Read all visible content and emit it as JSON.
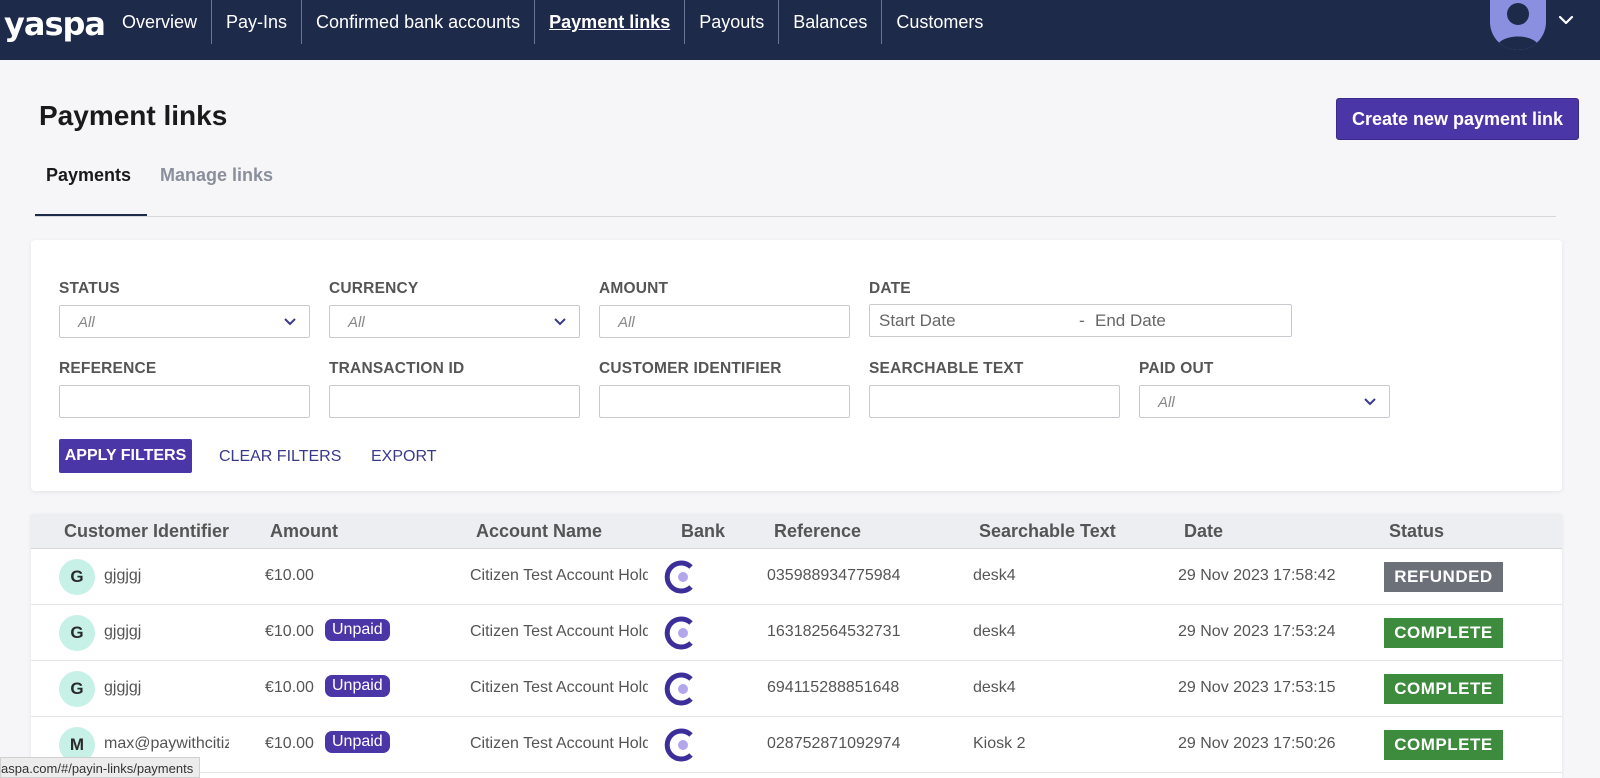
{
  "nav": {
    "logo": "yaspa",
    "items": [
      {
        "label": "Overview"
      },
      {
        "label": "Pay-Ins"
      },
      {
        "label": "Confirmed bank accounts"
      },
      {
        "label": "Payment links"
      },
      {
        "label": "Payouts"
      },
      {
        "label": "Balances"
      },
      {
        "label": "Customers"
      }
    ],
    "active": "Payment links"
  },
  "page": {
    "title": "Payment links",
    "create_button": "Create new payment link"
  },
  "tabs": [
    {
      "label": "Payments",
      "active": true
    },
    {
      "label": "Manage links",
      "active": false
    }
  ],
  "filters": {
    "status": {
      "label": "STATUS",
      "value": "All"
    },
    "currency": {
      "label": "CURRENCY",
      "value": "All"
    },
    "amount": {
      "label": "AMOUNT",
      "placeholder": "All"
    },
    "date": {
      "label": "DATE",
      "start_placeholder": "Start Date",
      "separator": "-",
      "end_placeholder": "End Date"
    },
    "reference": {
      "label": "REFERENCE",
      "value": ""
    },
    "transaction_id": {
      "label": "TRANSACTION ID",
      "value": ""
    },
    "customer_identifier": {
      "label": "CUSTOMER IDENTIFIER",
      "value": ""
    },
    "searchable_text": {
      "label": "SEARCHABLE TEXT",
      "value": ""
    },
    "paid_out": {
      "label": "PAID OUT",
      "value": "All"
    },
    "apply_label": "APPLY FILTERS",
    "clear_label": "CLEAR FILTERS",
    "export_label": "EXPORT"
  },
  "table": {
    "columns": [
      "Customer Identifier",
      "Amount",
      "Account Name",
      "Bank",
      "Reference",
      "Searchable Text",
      "Date",
      "Status"
    ],
    "rows": [
      {
        "initial": "G",
        "customer": "gjgjgj",
        "amount": "€10.00",
        "unpaid": "",
        "account": "Citizen Test Account Holder",
        "reference": "035988934775984",
        "searchable": "desk4",
        "date": "29 Nov 2023 17:58:42",
        "status": "REFUNDED"
      },
      {
        "initial": "G",
        "customer": "gjgjgj",
        "amount": "€10.00",
        "unpaid": "Unpaid",
        "account": "Citizen Test Account Holder",
        "reference": "163182564532731",
        "searchable": "desk4",
        "date": "29 Nov 2023 17:53:24",
        "status": "COMPLETE"
      },
      {
        "initial": "G",
        "customer": "gjgjgj",
        "amount": "€10.00",
        "unpaid": "Unpaid",
        "account": "Citizen Test Account Holder",
        "reference": "694115288851648",
        "searchable": "desk4",
        "date": "29 Nov 2023 17:53:15",
        "status": "COMPLETE"
      },
      {
        "initial": "M",
        "customer": "max@paywithcitizen",
        "amount": "€10.00",
        "unpaid": "Unpaid",
        "account": "Citizen Test Account Holder",
        "reference": "028752871092974",
        "searchable": "Kiosk 2",
        "date": "29 Nov 2023 17:50:26",
        "status": "COMPLETE"
      }
    ]
  },
  "status_url": "aspa.com/#/payin-links/payments",
  "colors": {
    "nav_bg": "#1e2a4a",
    "accent": "#4b36a8",
    "complete": "#3d8b3d",
    "refunded": "#6c7079"
  }
}
